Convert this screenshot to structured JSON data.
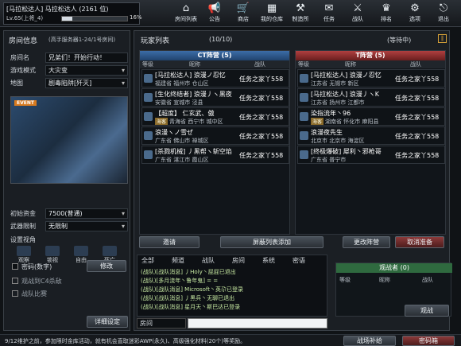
{
  "player": {
    "name": "[马拉松达人] 马拉松达人 (2161 位)",
    "level": "Lv.65(上将_4)",
    "progress_text": "16%",
    "progress": 0.16
  },
  "nav": [
    {
      "label": "房间列表",
      "icon": "home-icon"
    },
    {
      "label": "公告",
      "icon": "megaphone-icon"
    },
    {
      "label": "商店",
      "icon": "shop-icon"
    },
    {
      "label": "我的仓库",
      "icon": "warehouse-icon"
    },
    {
      "label": "制造所",
      "icon": "factory-icon"
    },
    {
      "label": "任务",
      "icon": "quest-icon"
    },
    {
      "label": "战队",
      "icon": "clan-icon"
    },
    {
      "label": "排名",
      "icon": "ranking-icon"
    },
    {
      "label": "选项",
      "icon": "gear-icon"
    },
    {
      "label": "退出",
      "icon": "exit-icon"
    }
  ],
  "room": {
    "title": "房间信息",
    "server": "(高手服务器1-24/1号房间)",
    "name_label": "房间名",
    "name": "兄弟们！开始行动！",
    "mode_label": "游戏模式",
    "mode": "大灾变",
    "map_label": "地图",
    "map": "剧毒陷阱[歼灭]",
    "event": "EVENT",
    "money_label": "初始资金",
    "money": "7500(普通)",
    "weapon_label": "武器限制",
    "weapon": "无限制",
    "view_label": "设置视角",
    "views": [
      "观察",
      "锁视",
      "自由",
      "死亡"
    ],
    "password": "密码(数字)",
    "modify": "修改",
    "option1": "观战到C4杀敌",
    "option2": "战队比赛",
    "detail": "详细设定"
  },
  "players": {
    "title": "玩家列表",
    "count": "(10/10)",
    "status": "(等待中)",
    "ct_team": "CT阵营 (5)",
    "t_team": "T阵营 (5)",
    "col_level": "等级",
    "col_nick": "昵称",
    "col_clan": "战队",
    "ct": [
      {
        "n1": "[马拉松达人] 浪漫ノ忍忆",
        "n2": "福建省 福州市 仓山区",
        "clan": "任务之家丫558"
      },
      {
        "n1": "[生化终结者] 浪漫丿ヽ黑夜",
        "n2": "安徽省 宣城市 泾县",
        "clan": "任务之家丫558"
      },
      {
        "n1": "【超度】 仁玄武、傲",
        "n2": "青海省 西宁市 城中区",
        "clan": "任务之家丫558",
        "tag": "海客"
      },
      {
        "n1": "浪漫ヽノ雪ぜ",
        "n2": "广东省 佛山市 禅城区",
        "clan": "任务之家丫558"
      },
      {
        "n1": "[杀戮机械] 丿黑帮ヽ斩空焰",
        "n2": "广东省 湛江市 霞山区",
        "clan": "任务之家丫558"
      }
    ],
    "t": [
      {
        "n1": "[马拉松达人] 浪漫ノ忍忆",
        "n2": "江苏省 无锡市 新区",
        "clan": "任务之家丫558"
      },
      {
        "n1": "[马拉松达人] 浪漫丿ヽK",
        "n2": "江苏省 扬州市 江都市",
        "clan": "任务之家丫558"
      },
      {
        "n1": "染指流年丶96",
        "n2": "湖南省 怀化市 麻阳县",
        "clan": "任务之家丫558",
        "tag": "海客"
      },
      {
        "n1": "浪漫夜先生",
        "n2": "北京市 北京市 海淀区",
        "clan": "任务之家丫558"
      },
      {
        "n1": "[终极爆破] 犀利丶邪枪哥",
        "n2": "广东省 普宁市",
        "clan": "任务之家丫558"
      }
    ],
    "invite": "邀请",
    "refresh": "屏蔽列表添加",
    "change": "更改阵营",
    "cancel_ready": "取消准备"
  },
  "chat": {
    "tabs": [
      "全部",
      "频道",
      "战队",
      "房间",
      "系统",
      "密语"
    ],
    "messages": [
      "(战队)[战队消息] 丿Holy丶屁屁已退出",
      "(战队)[多月流年丶鲁年鬼] = =",
      "(战队)[战队消息] Microsoft丶英尕已登录",
      "(战队)[战队消息] 丿黑兵丶无聊已退出",
      "(战队)[战队消息] 星月天丶斯巴达已登录"
    ],
    "target": "房间"
  },
  "observer": {
    "title": "观战者 (0)",
    "col_level": "等级",
    "col_nick": "昵称",
    "col_clan": "战队",
    "btn": "观战"
  },
  "footer": {
    "ticker": "9/12维护之前，参加限时金库活动，就有机会直取迷彩AWP(永久)、高级强化材料(20个)等奖励。",
    "btn1": "战场补给",
    "btn2": "密码箱"
  }
}
